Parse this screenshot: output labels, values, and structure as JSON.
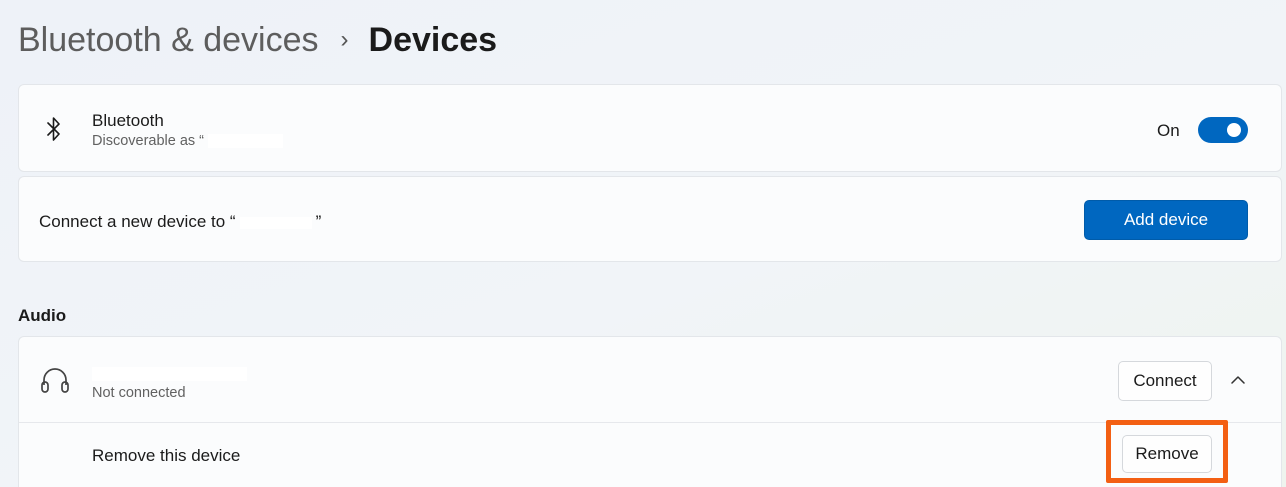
{
  "breadcrumb": {
    "parent": "Bluetooth & devices",
    "separator": "›",
    "current": "Devices"
  },
  "bluetooth": {
    "title": "Bluetooth",
    "subtitle": "Discoverable as “",
    "toggle_label": "On",
    "toggle_on": true,
    "icon": "bluetooth-icon"
  },
  "connect": {
    "prefix": "Connect a new device to “",
    "suffix": "”",
    "button": "Add device"
  },
  "audio": {
    "section_title": "Audio",
    "device": {
      "icon": "headphones-icon",
      "status": "Not connected",
      "connect_button": "Connect",
      "expand_icon": "chevron-up-icon"
    },
    "remove": {
      "label": "Remove this device",
      "button": "Remove"
    }
  },
  "colors": {
    "accent": "#0067c0",
    "highlight": "#f35f13"
  }
}
